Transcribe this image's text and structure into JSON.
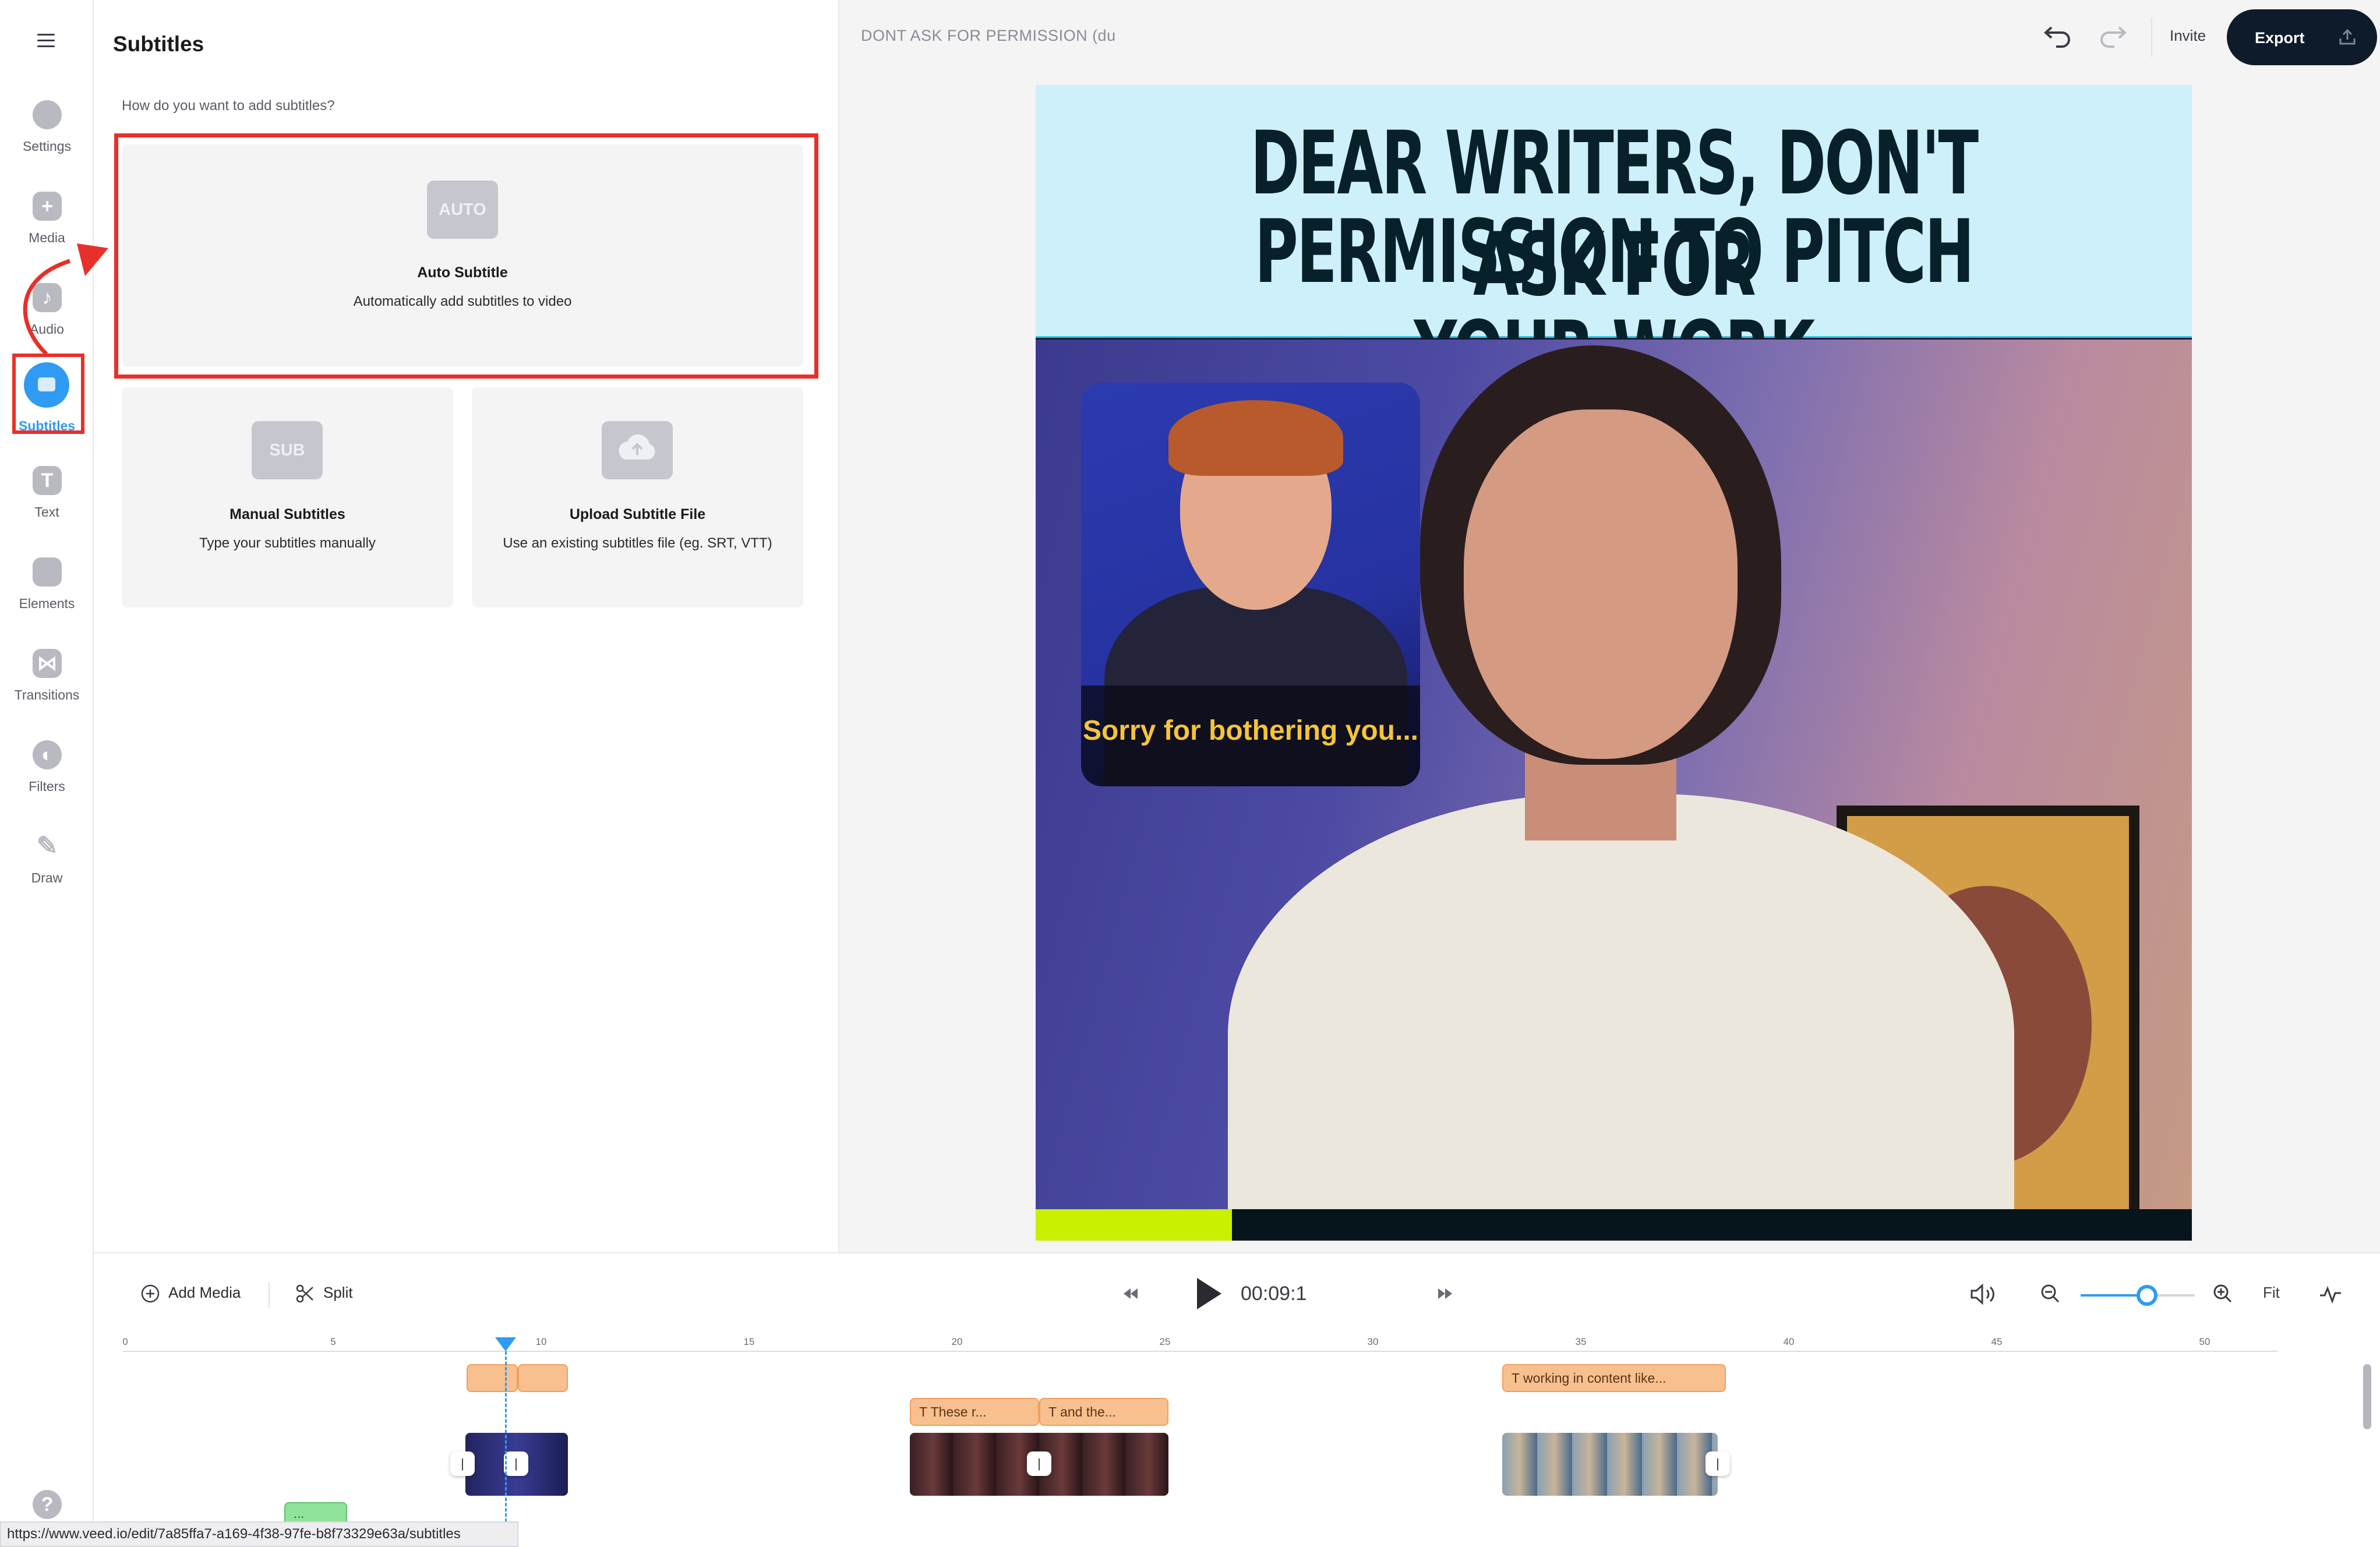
{
  "nav": {
    "menu_icon": "hamburger-menu-icon",
    "items": [
      {
        "label": "Settings",
        "icon": "settings-icon"
      },
      {
        "label": "Media",
        "icon": "plus-icon"
      },
      {
        "label": "Audio",
        "icon": "music-note-icon"
      },
      {
        "label": "Subtitles",
        "icon": "subtitles-icon",
        "active": true
      },
      {
        "label": "Text",
        "icon": "text-icon"
      },
      {
        "label": "Elements",
        "icon": "elements-icon"
      },
      {
        "label": "Transitions",
        "icon": "transitions-icon"
      },
      {
        "label": "Filters",
        "icon": "filters-icon"
      },
      {
        "label": "Draw",
        "icon": "pencil-icon"
      }
    ],
    "help_label": "?"
  },
  "panel": {
    "title": "Subtitles",
    "question": "How do you want to add subtitles?",
    "options": [
      {
        "icon_text": "AUTO",
        "title": "Auto Subtitle",
        "desc": "Automatically add subtitles to video"
      },
      {
        "icon_text": "SUB",
        "title": "Manual Subtitles",
        "desc": "Type your subtitles manually"
      },
      {
        "icon_text": "",
        "title": "Upload Subtitle File",
        "desc": "Use an existing subtitles file (eg. SRT, VTT)"
      }
    ]
  },
  "header": {
    "project_title": "DONT ASK FOR PERMISSION (du",
    "invite_label": "Invite",
    "export_label": "Export"
  },
  "canvas": {
    "title_line1": "DEAR WRITERS, DON'T ASK FOR",
    "title_line2": "PERMISSION TO PITCH YOUR WORK",
    "gif_caption": "Sorry for bothering you...",
    "progress": 0.17,
    "colors": {
      "title_bg": "#cdf0fa",
      "title_text": "#07202a",
      "progress_fill": "#c8f000",
      "progress_track": "#06141c"
    }
  },
  "timeline": {
    "add_media_label": "Add Media",
    "split_label": "Split",
    "timecode": "00:09:1",
    "fit_label": "Fit",
    "zoom_level": 0.58,
    "ruler_labels": [
      "0",
      "5",
      "10",
      "15",
      "20",
      "25",
      "30",
      "35",
      "40",
      "45",
      "50"
    ],
    "text_clips": [
      {
        "label": ""
      },
      {
        "label": ""
      },
      {
        "label": "These r..."
      },
      {
        "label": "and the..."
      },
      {
        "label": "working in content like..."
      }
    ],
    "green_clip_label": "..."
  },
  "status_url": "https://www.veed.io/edit/7a85ffa7-a169-4f38-97fe-b8f73329e63a/subtitles",
  "accent_color": "#2f9bf2",
  "highlight_color": "#e8302a"
}
